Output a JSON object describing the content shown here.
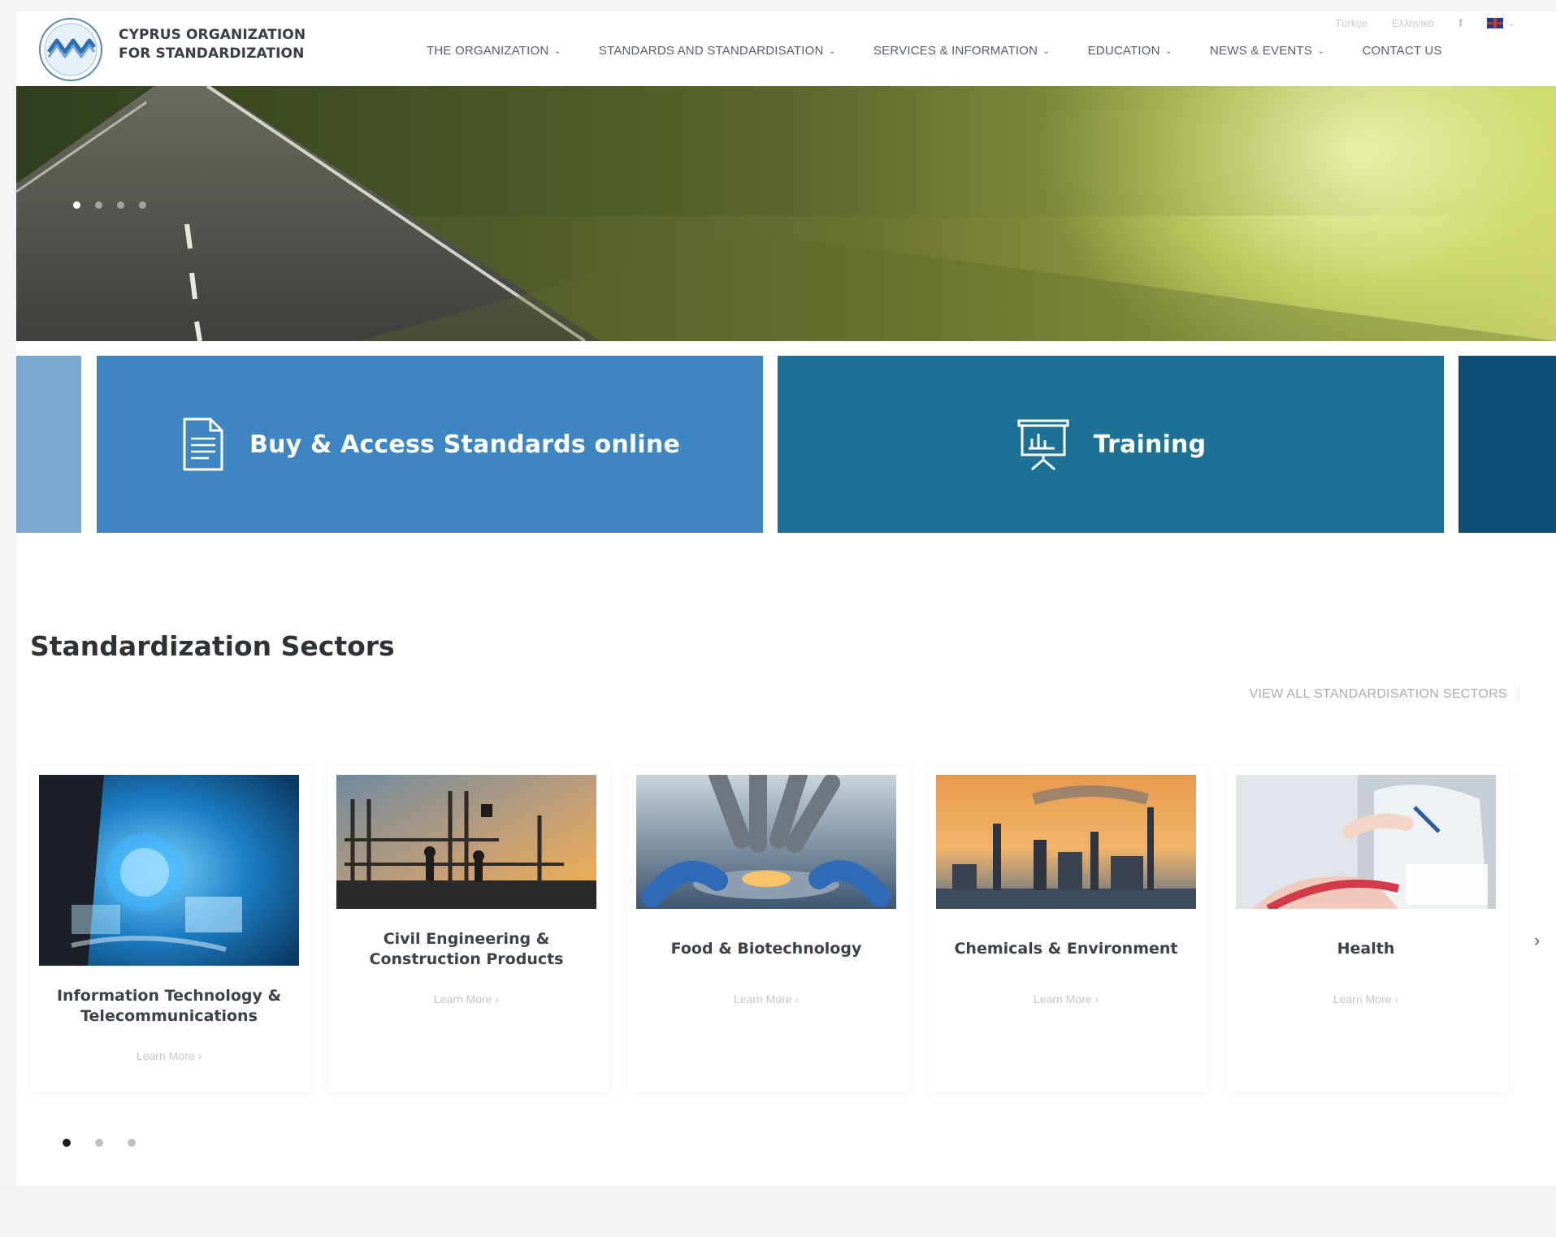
{
  "org": {
    "name_line1": "CYPRUS ORGANIZATION",
    "name_line2": "FOR STANDARDIZATION"
  },
  "top_util": {
    "lang_1": "Türkçe",
    "lang_2": "Ελληνικά",
    "facebook": "f",
    "lang_caret": "⌄"
  },
  "nav": {
    "items": [
      {
        "label": "THE ORGANIZATION",
        "caret": "⌄"
      },
      {
        "label": "STANDARDS AND STANDARDISATION",
        "caret": "⌄"
      },
      {
        "label": "SERVICES & INFORMATION",
        "caret": "⌄"
      },
      {
        "label": "EDUCATION",
        "caret": "⌄"
      },
      {
        "label": "NEWS & EVENTS",
        "caret": "⌄"
      },
      {
        "label": "CONTACT US"
      }
    ]
  },
  "tiles": {
    "buy_label": "Buy & Access Standards online",
    "training_label": "Training"
  },
  "sectors": {
    "title": "Standardization Sectors",
    "view_all": "VIEW ALL STANDARDISATION SECTORS",
    "next": "›",
    "cards": [
      {
        "title": "Information Technology &\nTelecommunications",
        "link": "Learn More ›"
      },
      {
        "title": "Civil Engineering &\nConstruction Products",
        "link": "Learn More ›"
      },
      {
        "title": "Food & Biotechnology",
        "link": "Learn More ›"
      },
      {
        "title": "Chemicals & Environment",
        "link": "Learn More ›"
      },
      {
        "title": "Health",
        "link": "Learn More ›"
      }
    ]
  },
  "colors": {
    "tile_buy": "#3d86c2",
    "tile_training": "#1d7195",
    "tile_dark": "#0f4e74"
  }
}
